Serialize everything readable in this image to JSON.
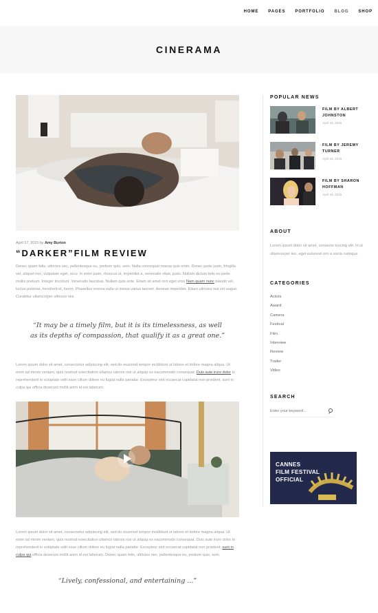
{
  "nav": {
    "items": [
      {
        "label": "HOME"
      },
      {
        "label": "PAGES"
      },
      {
        "label": "PORTFOLIO"
      },
      {
        "label": "BLOG"
      },
      {
        "label": "SHOP"
      }
    ],
    "active": "BLOG"
  },
  "site": {
    "title": "CINERAMA"
  },
  "post": {
    "date": "April 17, 2015 by",
    "author": "Amy Burton",
    "title": "“DARKER”FILM REVIEW",
    "para1": "Donec quam felis, ultricies nec, pellentesque eu, pretium quis, sem. Nulla consequat massa quis enim. Donec pede justo, fringilla vel, aliquet nec, vulputate eget, arcu. In enim justo, rhoncus ut, imperdiet a, venenatis vitae, justo. Nullam dictum felis eu pede mollis pretium. Integer tincidunt. Venenatis faucibus. Nullam quis ante. Etiam sit amet orci eget eros",
    "para1_link": "Nam quam nunc",
    "para1_end": " blandit vel, luctus pulvinar, hendrerit id, lorem. Phasellus viverra nulla ut metus varius laoreet. Aenean imperdiet. Etiam ultricies nisi vel augue. Curabitur ullamcorper ultricies nisi.",
    "quote": "“It may be a timely film, but it is its timelessness, as well as its depths of compassion, that qualify it as a great one.”",
    "para2_a": "Lorem ipsum dolor sit amet, consectetur adipiscing elit, sed do eiusmod tempor incididunt ut labore et dolore magna aliqua. Ut enim ad minim veniam, quis nostrud exercitation ullamco laboris nisi ut aliquip ex eacommodo consequat.",
    "para2_link": "Duis aute irure dolor",
    "para2_b": " in reprehenderit in voluptate velit esse cillum dolore eu fugiat nulla pariatur. Excepteur sint occaecat cupidatat non proident, sunt in culpa qui officia deserunt mollit anim id est laborum.",
    "para3_a": "Lorem ipsum dolor sit amet, consectetur adipiscing elit, sed do eiusmod tempor incididunt ut labore et dolore magna aliqua. Ut enim ad minim veniam, quis nostrud exercitation ullamco laboris nisi ut aliquip ex eacommodo consequat. Duis aute irure dolor in reprehenderit in voluptate velit esse cillum dolore eu fugiat nulla pariatur. Excepteur sint occaecat cupidatat non proident,",
    "para3_link": "sunt in culpa qui",
    "para3_b": " officia deserunt mollit anim id est laborum. Donec quam felis, ultricies nec, pellentesque eu, pretium quis, sem.",
    "quote2": "“Lively, confessional, and entertaining ...”"
  },
  "sidebar": {
    "popular_title": "POPULAR NEWS",
    "news": [
      {
        "title": "FILM BY ALBERT JOHNSTON",
        "date": "April 16, 2015"
      },
      {
        "title": "FILM BY JEREMY TURNER",
        "date": "April 16, 2015"
      },
      {
        "title": "FILM BY SHARON HOFFMAN",
        "date": "April 16, 2015"
      }
    ],
    "about_title": "ABOUT",
    "about_text": "Lorem ipsum dolor sit amet, consecte tuscing elit. In ut ullamcorper leo, eget euismod orci a sociis natoque",
    "categories_title": "CATEGORIES",
    "categories": [
      "Actors",
      "Award",
      "Camera",
      "Festival",
      "Film",
      "Interview",
      "Review",
      "Trailer",
      "Video"
    ],
    "search_title": "SEARCH",
    "search_placeholder": "Enter your keyword...",
    "banner_lines": [
      "CANNES",
      "FILM FESTIVAL",
      "OFFICIAL"
    ]
  },
  "colors": {
    "accent": "#111111",
    "muted_text": "#999999",
    "band_bg": "#f7f7f7",
    "banner_bg": "#23294a"
  }
}
